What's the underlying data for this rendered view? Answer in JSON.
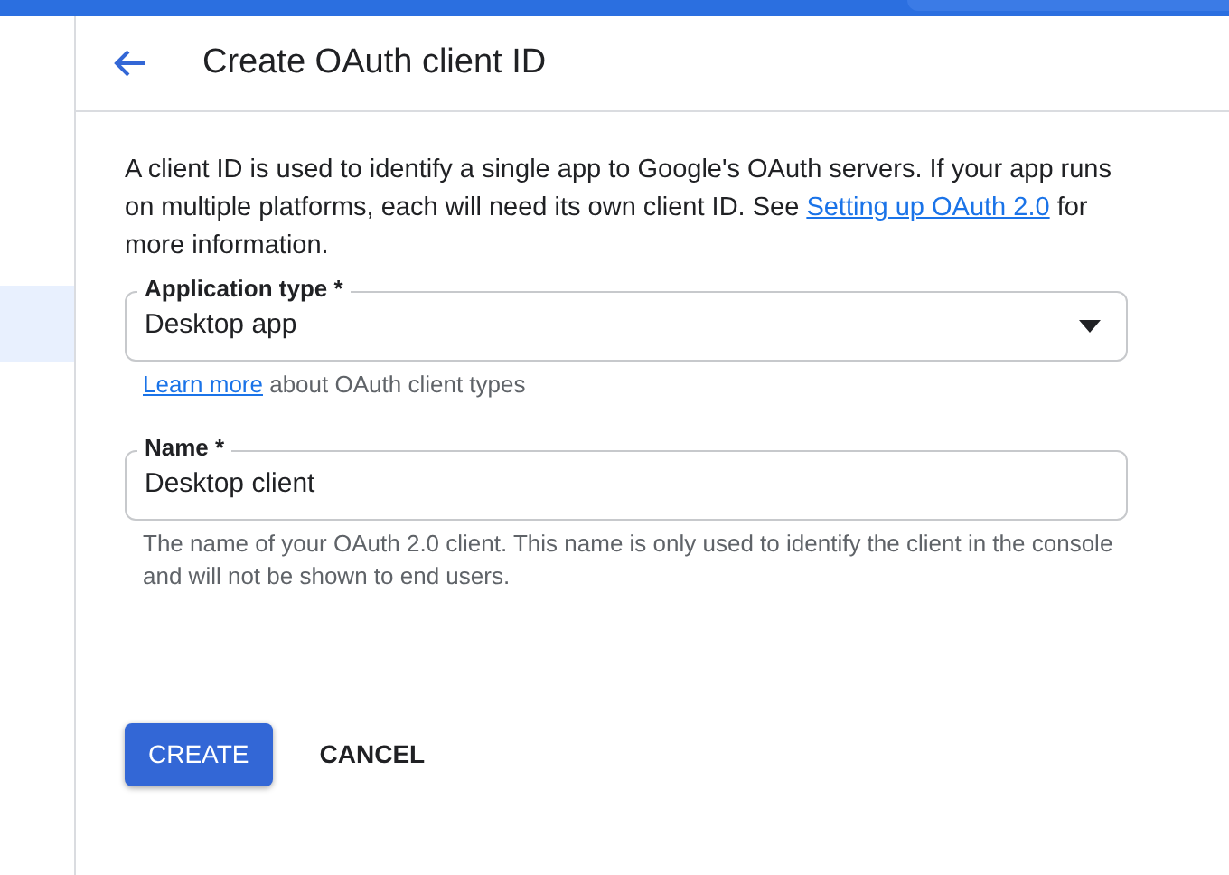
{
  "sidebar": {
    "items": [
      {
        "selected": true
      }
    ]
  },
  "header": {
    "title": "Create OAuth client ID"
  },
  "description": {
    "before": "A client ID is used to identify a single app to Google's OAuth servers. If your app runs on multiple platforms, each will need its own client ID. See ",
    "link": "Setting up OAuth 2.0",
    "after": " for more information."
  },
  "fields": [
    {
      "kind": "select",
      "label": "Application type *",
      "value": "Desktop app",
      "help_link": "Learn more",
      "help": "about OAuth client types"
    },
    {
      "kind": "text",
      "label": "Name *",
      "value": "Desktop client",
      "help": "The name of your OAuth 2.0 client. This name is only used to identify the client in the console and will not be shown to end users."
    }
  ],
  "buttons": [
    {
      "label": "CREATE",
      "kind": "primary"
    },
    {
      "label": "CANCEL",
      "kind": "text"
    }
  ]
}
